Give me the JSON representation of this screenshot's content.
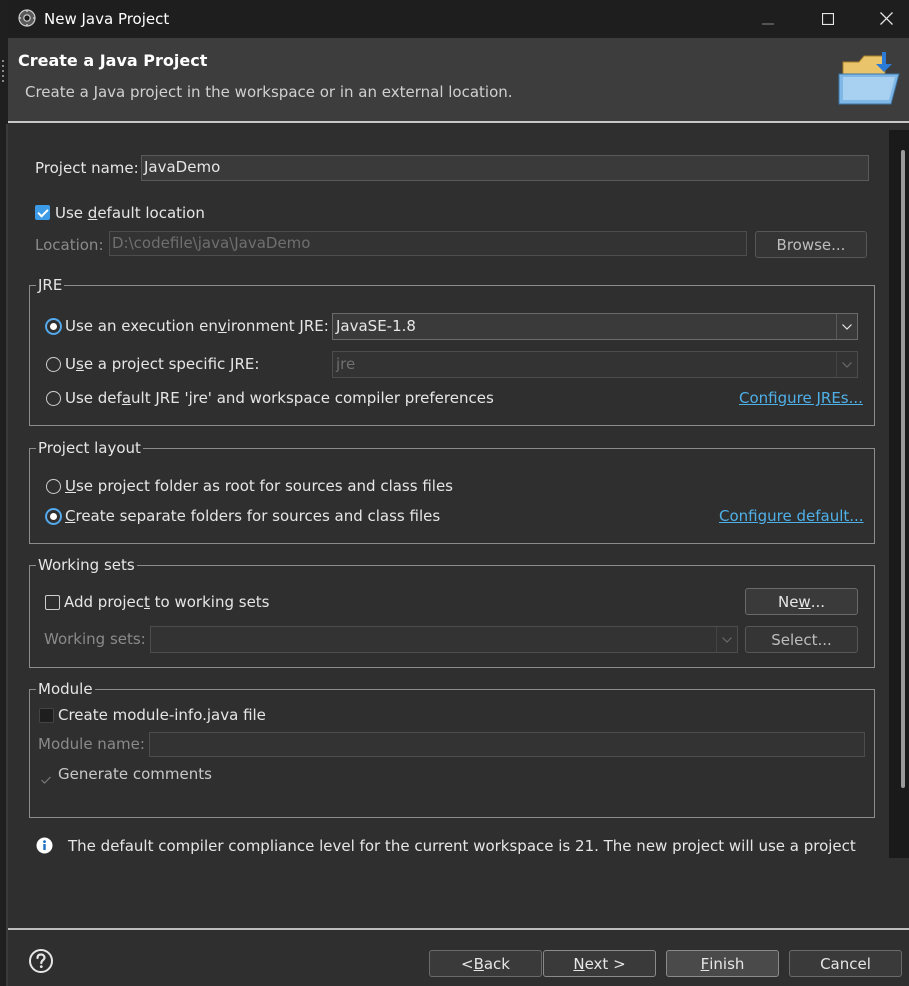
{
  "window": {
    "title": "New Java Project",
    "icons": {
      "app": "eclipse-logo-icon",
      "minimize": "minimize-icon",
      "maximize": "maximize-icon",
      "close": "close-icon"
    }
  },
  "banner": {
    "title": "Create a Java Project",
    "description": "Create a Java project in the workspace or in an external location.",
    "icon": "folder-icon"
  },
  "project": {
    "name_label": "Project name:",
    "name_value": "JavaDemo"
  },
  "location": {
    "use_default_label": "Use default location",
    "use_default_checked": true,
    "location_label": "Location:",
    "location_value": "D:\\codefile\\java\\JavaDemo",
    "browse_label": "Browse..."
  },
  "jre": {
    "group_title": "JRE",
    "options": [
      {
        "label": "Use an execution environment JRE:",
        "selected": true
      },
      {
        "label": "Use a project specific JRE:",
        "selected": false
      },
      {
        "label": "Use default JRE 'jre' and workspace compiler preferences",
        "selected": false
      }
    ],
    "exec_env_value": "JavaSE-1.8",
    "project_jre_value": "jre",
    "configure_link": "Configure JREs..."
  },
  "layout": {
    "group_title": "Project layout",
    "options": [
      {
        "label": "Use project folder as root for sources and class files",
        "selected": false
      },
      {
        "label": "Create separate folders for sources and class files",
        "selected": true
      }
    ],
    "configure_link": "Configure default..."
  },
  "working_sets": {
    "group_title": "Working sets",
    "add_label": "Add project to working sets",
    "add_checked": false,
    "new_label": "New...",
    "sets_label": "Working sets:",
    "sets_value": "",
    "select_label": "Select..."
  },
  "module": {
    "group_title": "Module",
    "create_label": "Create module-info.java file",
    "create_checked": false,
    "name_label": "Module name:",
    "name_value": "",
    "comments_label": "Generate comments"
  },
  "info": {
    "icon": "info-icon",
    "message": "The default compiler compliance level for the current workspace is 21. The new project will use a project"
  },
  "footer": {
    "help_icon": "help-icon",
    "back_label": "< Back",
    "next_label": "Next >",
    "finish_label": "Finish",
    "cancel_label": "Cancel"
  },
  "colors": {
    "accent": "#3d9ae6",
    "link": "#4fb0e8",
    "dialog_bg": "#2f2f2f",
    "titlebar_bg": "#1e1e1e"
  }
}
